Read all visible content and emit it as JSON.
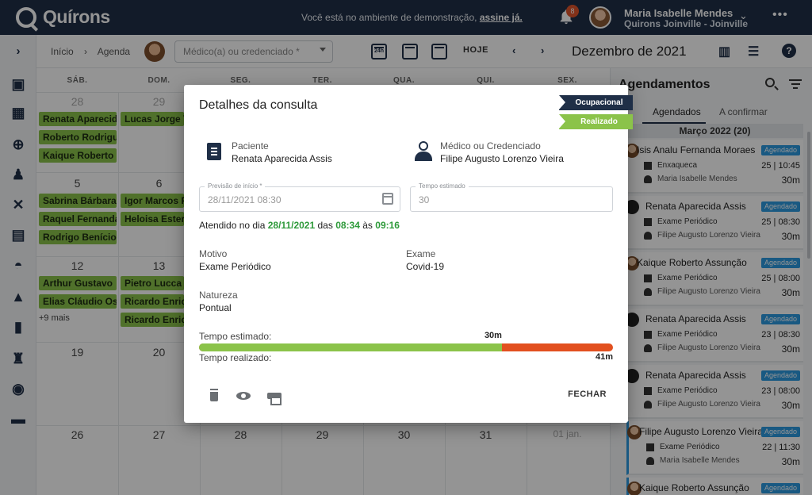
{
  "header": {
    "brand": "Quírons",
    "demo_text": "Você está no ambiente de demonstração,",
    "demo_link": "assine já.",
    "notifications_count": "8",
    "user_name": "Maria Isabelle Mendes",
    "user_unit": "Quirons Joinville - Joinville"
  },
  "toolbar": {
    "breadcrumb_home": "Início",
    "breadcrumb_current": "Agenda",
    "doctor_placeholder": "Médico(a) ou credenciado *",
    "view_24h": "24h",
    "today_label": "HOJE",
    "month_title": "Dezembro de 2021"
  },
  "calendar": {
    "weekdays": [
      "SÁB.",
      "DOM.",
      "SEG.",
      "TER.",
      "QUA.",
      "QUI.",
      "SEX."
    ],
    "row1": [
      "28",
      "29"
    ],
    "row2": [
      "5",
      "6"
    ],
    "row3": [
      "12",
      "13"
    ],
    "row4": [
      "19",
      "20"
    ],
    "row5": [
      "26",
      "27",
      "28",
      "29",
      "30",
      "31",
      "01 jan."
    ],
    "events_sat_1": [
      "Renata Aparecida",
      "Roberto Rodrigues",
      "Kaique Roberto"
    ],
    "events_sun_1": [
      "Lucas Jorge Ya"
    ],
    "events_sat_2": [
      "Sabrina Bárbara",
      "Raquel Fernanda",
      "Rodrigo Benício"
    ],
    "events_sun_2": [
      "Igor Marcos Pi",
      "Heloisa Ester M"
    ],
    "events_sat_3": [
      "Arthur Gustavo",
      "Elias Cláudio Os"
    ],
    "events_sun_3": [
      "Pietro Lucca Go",
      "Ricardo Enrico",
      "Ricardo Enrico"
    ],
    "more_label": "+9 mais"
  },
  "agenda": {
    "title": "Agendamentos",
    "tab_scheduled": "Agendados",
    "tab_to_confirm": "A confirmar",
    "group_label": "Março 2022 (20)",
    "items": [
      {
        "name": "Isis Analu Fernanda Moraes",
        "status": "Agendado",
        "exam": "Enxaqueca",
        "doctor": "Maria Isabelle Mendes",
        "date": "25 | 10:45",
        "duration": "30m"
      },
      {
        "name": "Renata Aparecida Assis",
        "status": "Agendado",
        "exam": "Exame Periódico",
        "doctor": "Filipe Augusto Lorenzo Vieira",
        "date": "25 | 08:30",
        "duration": "30m"
      },
      {
        "name": "Kaique Roberto Assunção",
        "status": "Agendado",
        "exam": "Exame Periódico",
        "doctor": "Filipe Augusto Lorenzo Vieira",
        "date": "25 | 08:00",
        "duration": "30m"
      },
      {
        "name": "Renata Aparecida Assis",
        "status": "Agendado",
        "exam": "Exame Periódico",
        "doctor": "Filipe Augusto Lorenzo Vieira",
        "date": "23 | 08:30",
        "duration": "30m"
      },
      {
        "name": "Renata Aparecida Assis",
        "status": "Agendado",
        "exam": "Exame Periódico",
        "doctor": "Filipe Augusto Lorenzo Vieira",
        "date": "23 | 08:00",
        "duration": "30m"
      },
      {
        "name": "Filipe Augusto Lorenzo Vieira",
        "status": "Agendado",
        "exam": "Exame Periódico",
        "doctor": "Maria Isabelle Mendes",
        "date": "22 | 11:30",
        "duration": "30m"
      },
      {
        "name": "Kaique Roberto Assunção",
        "status": "Agendado"
      }
    ]
  },
  "modal": {
    "title": "Detalhes da consulta",
    "type_badge": "Ocupacional",
    "status_badge": "Realizado",
    "patient_label": "Paciente",
    "patient_name": "Renata Aparecida Assis",
    "doctor_label": "Médico ou Credenciado",
    "doctor_name": "Filipe Augusto Lorenzo Vieira",
    "start_label": "Previsão de início *",
    "start_value": "28/11/2021 08:30",
    "duration_label": "Tempo estimado",
    "duration_value": "30",
    "attended_prefix": "Atendido no dia",
    "attended_date": "28/11/2021",
    "attended_between": "das",
    "attended_from": "08:34",
    "attended_and": "às",
    "attended_to": "09:16",
    "reason_label": "Motivo",
    "reason_value": "Exame Periódico",
    "exam_label": "Exame",
    "exam_value": "Covid-19",
    "nature_label": "Natureza",
    "nature_value": "Pontual",
    "estimated_label": "Tempo estimado:",
    "estimated_value": "30m",
    "actual_label": "Tempo realizado:",
    "actual_value": "41m",
    "estimated_minutes": 30,
    "actual_minutes": 41,
    "close_label": "FECHAR"
  },
  "colors": {
    "navy": "#1f2f47",
    "green": "#8bc34a",
    "overrun": "#e2501f",
    "status_blue": "#2c9ae0"
  }
}
